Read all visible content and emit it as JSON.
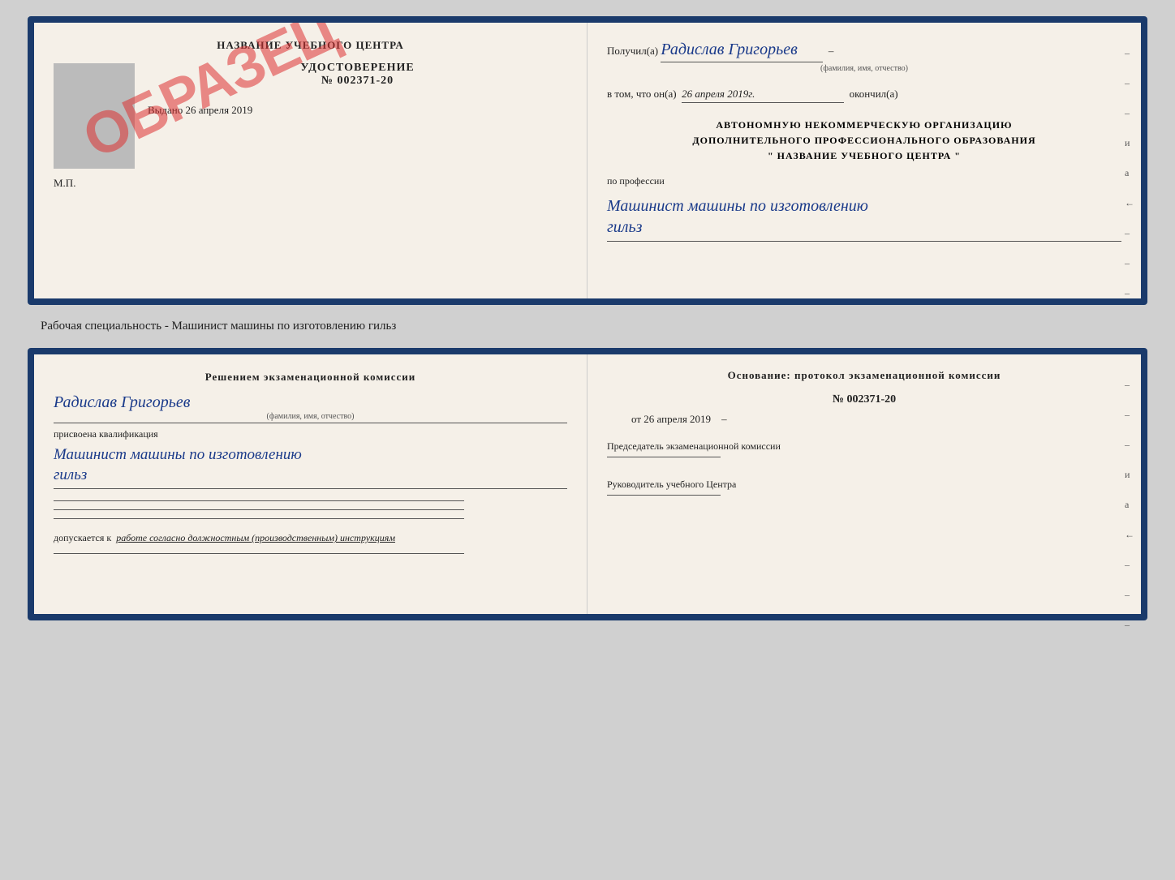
{
  "top_doc": {
    "left": {
      "title": "НАЗВАНИЕ УЧЕБНОГО ЦЕНТРА",
      "stamp": "ОБРАЗЕЦ",
      "udostoverenie": "УДОСТОВЕРЕНИЕ",
      "number": "№ 002371-20",
      "vydano_label": "Выдано",
      "vydano_date": "26 апреля 2019",
      "mp": "М.П."
    },
    "right": {
      "poluchil_prefix": "Получил(а)",
      "name_handwritten": "Радислав Григорьев",
      "name_caption": "(фамилия, имя, отчество)",
      "vtom_prefix": "в том, что он(а)",
      "vtom_date": "26 апреля 2019г.",
      "okonchil": "окончил(а)",
      "org_line1": "АВТОНОМНУЮ НЕКОММЕРЧЕСКУЮ ОРГАНИЗАЦИЮ",
      "org_line2": "ДОПОЛНИТЕЛЬНОГО ПРОФЕССИОНАЛЬНОГО ОБРАЗОВАНИЯ",
      "org_name": "\"   НАЗВАНИЕ УЧЕБНОГО ЦЕНТРА   \"",
      "po_professii": "по профессии",
      "profession1": "Машинист машины по изготовлению",
      "profession2": "гильз"
    }
  },
  "separator": {
    "text": "Рабочая специальность - Машинист машины по изготовлению гильз"
  },
  "bottom_doc": {
    "left": {
      "heading": "Решением  экзаменационной  комиссии",
      "name_handwritten": "Радислав Григорьев",
      "name_caption": "(фамилия, имя, отчество)",
      "prisvoena": "присвоена квалификация",
      "profession1": "Машинист машины по изготовлению",
      "profession2": "гильз",
      "dopuskaetsya_prefix": "допускается к",
      "dopuskaetsya_text": "работе согласно должностным (производственным) инструкциям"
    },
    "right": {
      "heading": "Основание: протокол экзаменационной  комиссии",
      "number": "№  002371-20",
      "ot_prefix": "от",
      "ot_date": "26 апреля 2019",
      "chairman_label": "Председатель экзаменационной комиссии",
      "director_label": "Руководитель учебного Центра"
    }
  }
}
